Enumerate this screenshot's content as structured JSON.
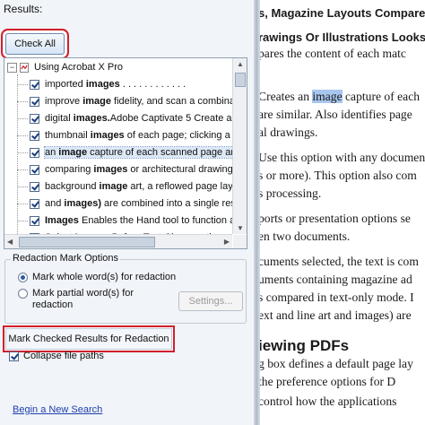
{
  "panel": {
    "results_label": "Results:",
    "check_all_label": "Check All",
    "root_label": "Using Acrobat X Pro",
    "root_expander": "−",
    "results": [
      {
        "pre": "imported ",
        "bold": "images",
        "post": " . . . . . . . . . . . ."
      },
      {
        "pre": "improve ",
        "bold": "image",
        "post": " fidelity, and scan a combina"
      },
      {
        "pre": "digital ",
        "bold": "images.",
        "post": "Adobe Captivate 5 Create an"
      },
      {
        "pre": "thumbnail ",
        "bold": "images",
        "post": " of each page; clicking a t"
      },
      {
        "pre": "an ",
        "bold": "image",
        "post": " capture of each scanned page and"
      },
      {
        "pre": "comparing ",
        "bold": "images",
        "post": " or architectural drawings"
      },
      {
        "pre": "background ",
        "bold": "image",
        "post": " art, a reflowed page lay"
      },
      {
        "pre": "and ",
        "bold": "images)",
        "post": " are combined into a single resu"
      },
      {
        "pre": "",
        "bold": "Images",
        "post": " Enables the Hand tool to function a"
      },
      {
        "pre": "Select ",
        "bold": "Images",
        "post": " Before Text Changes the orde"
      }
    ],
    "redaction_title": "Redaction Mark Options",
    "option_whole": "Mark whole word(s) for redaction",
    "option_partial_line1": "Mark partial word(s) for",
    "option_partial_line2": "redaction",
    "settings_label": "Settings...",
    "mark_checked_label": "Mark Checked Results for Redaction",
    "collapse_label": "Collapse file paths",
    "begin_search_label": "Begin a New Search",
    "selected_result_index": 4
  },
  "document": {
    "lines": [
      {
        "text": "s, Magazine Layouts  Compares",
        "style": "head"
      },
      {
        "text": "rawings Or Illustrations  Looks",
        "style": "head"
      },
      {
        "text": "pares the content of each matc"
      },
      {
        "text": "Creates an ",
        "highlight": "image",
        "rest": " capture of each"
      },
      {
        "text": "are similar. Also identifies page"
      },
      {
        "text": "al drawings."
      },
      {
        "text": "Use this option with any documen"
      },
      {
        "text": "s or more). This option also com"
      },
      {
        "text": "s processing."
      },
      {
        "text": "ports or presentation options se"
      },
      {
        "text": "en two documents."
      },
      {
        "text": "cuments selected, the text is com"
      },
      {
        "text": "uments containing magazine ad"
      },
      {
        "text": "s compared in text-only mode. I"
      },
      {
        "text": "ext and line art and images) are"
      },
      {
        "text": "iewing PDFs",
        "style": "big"
      },
      {
        "text": "g box defines a default page lay"
      },
      {
        "text": "the preference options for D"
      },
      {
        "text": "control how the applications"
      }
    ]
  },
  "colors": {
    "callout_red": "#d21f2c",
    "link_blue": "#1d3fae",
    "highlight": "#a9c6ee"
  }
}
